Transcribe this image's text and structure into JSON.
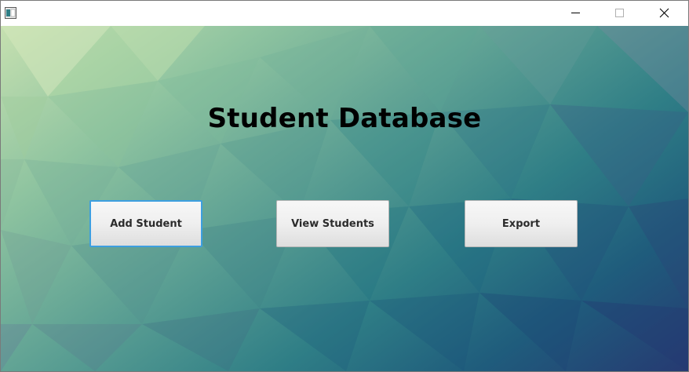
{
  "window": {
    "icon": "java-app-icon",
    "controls": {
      "minimize_icon": "minimize-icon",
      "maximize_icon": "maximize-icon",
      "close_icon": "close-icon"
    }
  },
  "main": {
    "title": "Student Database",
    "buttons": [
      {
        "label": "Add Student",
        "focused": true
      },
      {
        "label": "View Students",
        "focused": false
      },
      {
        "label": "Export",
        "focused": false
      }
    ]
  },
  "colors": {
    "focus_ring": "#3d9fe0",
    "background_top_left": "#c6e0b0",
    "background_bottom_right": "#263a72"
  }
}
